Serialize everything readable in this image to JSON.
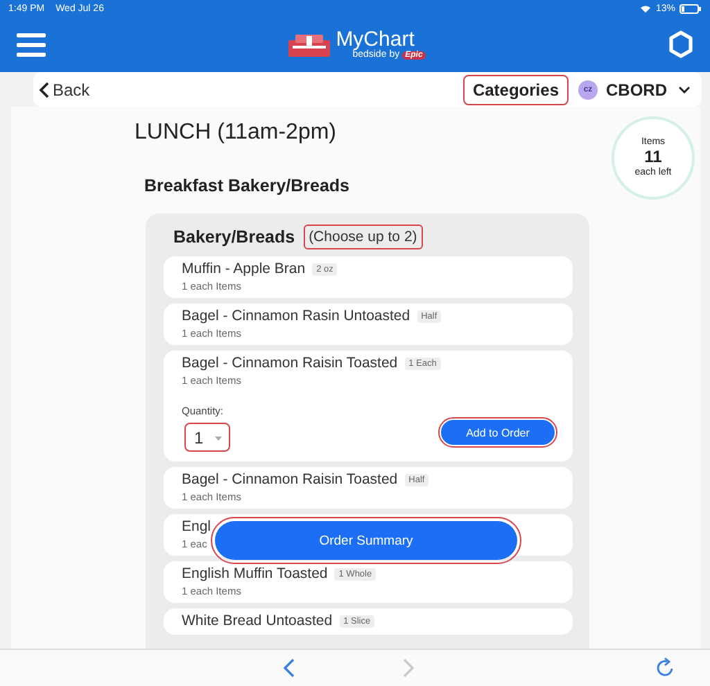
{
  "status_bar": {
    "time": "1:49 PM",
    "date": "Wed Jul 26",
    "battery": "13%"
  },
  "header": {
    "logo_text": "MyChart",
    "logo_subtext": "bedside",
    "logo_by": "by",
    "logo_brand": "Epic"
  },
  "nav": {
    "back": "Back",
    "categories": {
      "label": "Categories",
      "highlighted": true
    },
    "account": {
      "initials": "cz",
      "label": "CBORD"
    }
  },
  "meal": {
    "title": "LUNCH (11am-2pm)",
    "section": "Breakfast Bakery/Breads"
  },
  "counter": {
    "label": "Items",
    "count": "11",
    "sublabel": "each left"
  },
  "group": {
    "title": "Bakery/Breads",
    "limit": {
      "text": "(Choose up to 2)",
      "highlighted": true
    },
    "items": [
      {
        "name": "Muffin - Apple Bran",
        "portion": "2 oz",
        "detail": "1 each Items",
        "expanded": false
      },
      {
        "name": "Bagel - Cinnamon Rasin Untoasted",
        "portion": "Half",
        "detail": "1 each Items",
        "expanded": false
      },
      {
        "name": "Bagel - Cinnamon Raisin Toasted",
        "portion": "1 Each",
        "detail": "1 each Items",
        "expanded": true,
        "quantity_label": "Quantity:",
        "quantity": "1",
        "quantity_highlighted": true,
        "add_button": "Add to Order",
        "add_highlighted": true
      },
      {
        "name": "Bagel - Cinnamon Raisin Toasted",
        "portion": "Half",
        "detail": "1 each Items",
        "expanded": false
      },
      {
        "name": "Engl",
        "detail": "1 eac",
        "expanded": false
      },
      {
        "name": "English Muffin Toasted",
        "portion": "1 Whole",
        "detail": "1 each Items",
        "expanded": false
      },
      {
        "name": "White Bread Untoasted",
        "portion": "1 Slice",
        "expanded": false
      }
    ]
  },
  "order_summary": {
    "label": "Order Summary",
    "highlighted": true
  }
}
